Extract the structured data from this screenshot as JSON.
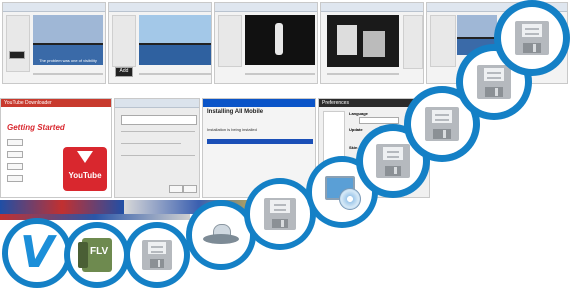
{
  "thumbnails": {
    "top_row": {
      "caption": "The problem was one of visibility",
      "add_button": "Add"
    },
    "youtube_downloader": {
      "title": "YouTube Downloader",
      "heading": "Getting Started",
      "logo_text": "YouTube"
    },
    "installer": {
      "title": "Installing All Mobile",
      "status": "Installation is being installed"
    },
    "preferences": {
      "title": "Preferences",
      "section1": "Language",
      "section2": "Update",
      "section3": "Skin"
    }
  },
  "badges": [
    {
      "icon": "v-logo-icon"
    },
    {
      "icon": "flv-icon"
    },
    {
      "icon": "floppy-disk-icon"
    },
    {
      "icon": "ufo-icon"
    },
    {
      "icon": "floppy-disk-icon"
    },
    {
      "icon": "monitor-cd-icon"
    },
    {
      "icon": "floppy-disk-icon"
    },
    {
      "icon": "floppy-disk-icon"
    },
    {
      "icon": "floppy-disk-icon"
    },
    {
      "icon": "floppy-disk-icon"
    }
  ],
  "colors": {
    "badge_ring": "#1480c6",
    "youtube_red": "#d9272e"
  }
}
